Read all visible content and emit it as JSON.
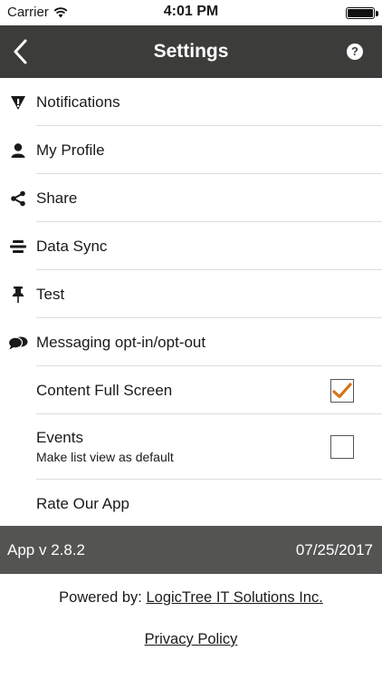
{
  "status_bar": {
    "carrier": "Carrier",
    "time": "4:01 PM"
  },
  "nav": {
    "title": "Settings",
    "help": "?"
  },
  "menu": {
    "items": [
      {
        "label": "Notifications",
        "icon": "warning-shield-icon"
      },
      {
        "label": "My Profile",
        "icon": "person-icon"
      },
      {
        "label": "Share",
        "icon": "share-icon"
      },
      {
        "label": "Data Sync",
        "icon": "data-sync-icon"
      },
      {
        "label": "Test",
        "icon": "pushpin-icon"
      },
      {
        "label": "Messaging opt-in/opt-out",
        "icon": "chat-bubbles-icon"
      }
    ],
    "content_full_screen": {
      "label": "Content Full Screen",
      "checked": true
    },
    "events": {
      "label": "Events",
      "sublabel": "Make list view as default",
      "checked": false
    },
    "rate": {
      "label": "Rate Our App"
    }
  },
  "footer": {
    "version": "App v 2.8.2",
    "date": "07/25/2017"
  },
  "powered": {
    "prefix": "Powered by:",
    "link": "LogicTree IT Solutions Inc."
  },
  "privacy": {
    "label": "Privacy Policy"
  },
  "colors": {
    "nav_bg": "#3c3d3b",
    "footer_bg": "#545553",
    "check_color": "#d4731e"
  }
}
